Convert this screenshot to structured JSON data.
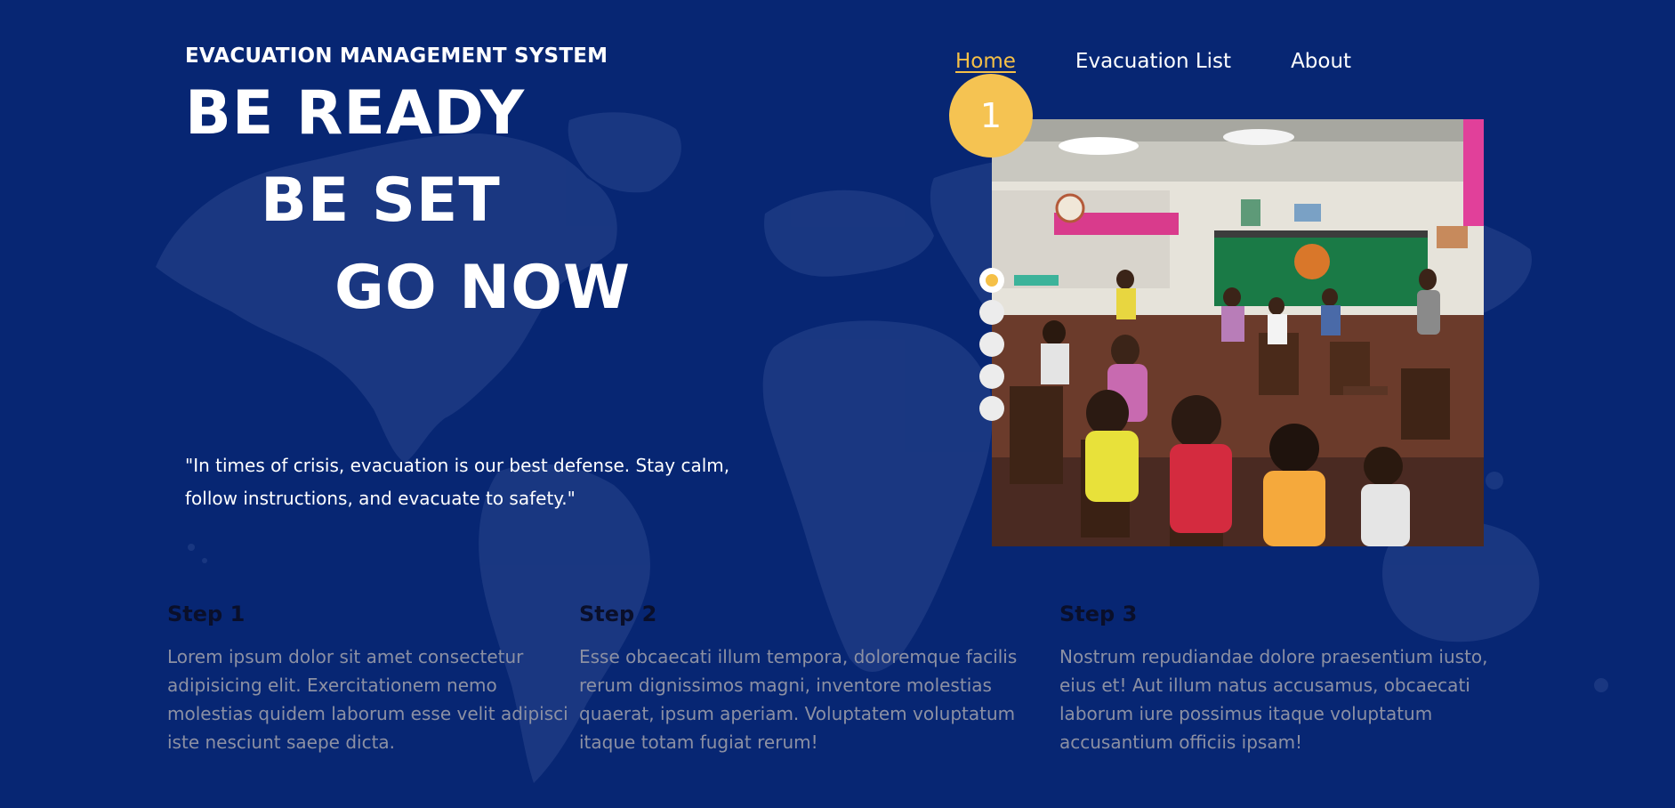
{
  "app": {
    "title": "EVACUATION MANAGEMENT SYSTEM"
  },
  "hero": {
    "line1": "BE READY",
    "line2": "BE SET",
    "line3": "GO NOW",
    "quote": "\"In times of crisis, evacuation is our best defense. Stay calm, follow instructions, and evacuate to safety.\""
  },
  "nav": {
    "items": [
      {
        "label": "Home",
        "active": true
      },
      {
        "label": "Evacuation List",
        "active": false
      },
      {
        "label": "About",
        "active": false
      }
    ]
  },
  "slider": {
    "current_number": "1",
    "dot_count": 5,
    "active_dot": 0
  },
  "steps": [
    {
      "title": "Step 1",
      "text": "Lorem ipsum dolor sit amet consectetur adipisicing elit. Exercitationem nemo molestias quidem laborum esse velit adipisci iste nesciunt saepe dicta."
    },
    {
      "title": "Step 2",
      "text": "Esse obcaecati illum tempora, doloremque facilis rerum dignissimos magni, inventore molestias quaerat, ipsum aperiam. Voluptatem voluptatum itaque totam fugiat rerum!"
    },
    {
      "title": "Step 3",
      "text": "Nostrum repudiandae dolore praesentium iusto, eius et! Aut illum natus accusamus, obcaecati laborum iure possimus itaque voluptatum accusantium officiis ipsam!"
    }
  ],
  "colors": {
    "background": "#072673",
    "accent": "#f5c047",
    "step_title": "#0a0f2a",
    "step_text": "#8c90a3"
  }
}
